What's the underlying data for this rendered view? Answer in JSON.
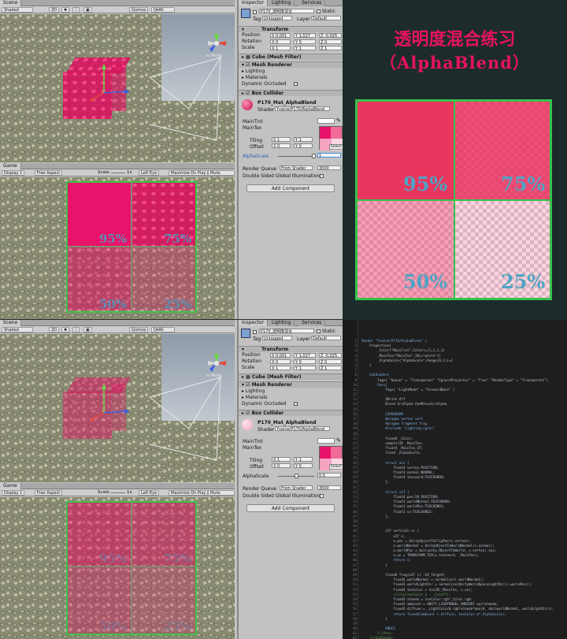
{
  "scene_tab": "Scene",
  "game_tab": "Game",
  "shaded": "Shaded",
  "mode_2d": "2D",
  "gizmos": "Gizmos",
  "gizmo_search": "Q▾All",
  "persp": "≡ Persp",
  "display": "Display 1",
  "aspect": "Free Aspect",
  "scale_label": "Scale",
  "scale_value": "1x",
  "left_eye": "Left Eye",
  "maximize": "Maximize On Play",
  "mute": "Mute Audio",
  "inspector_tab": "Inspector",
  "lighting_tab": "Lighting",
  "services_tab": "Services",
  "object_name": "P170_透明度混合",
  "static": "Static",
  "tag_label": "Tag",
  "tag_value": "Untagged",
  "layer_label": "Layer",
  "layer_value": "Default",
  "transform": {
    "title": "Transform",
    "rows": [
      {
        "label": "Position",
        "x": "0.001",
        "y": "1.027",
        "z": "-0.025"
      },
      {
        "label": "Rotation",
        "x": "0",
        "y": "0",
        "z": "0"
      },
      {
        "label": "Scale",
        "x": "1",
        "y": "1",
        "z": "1"
      }
    ]
  },
  "components": {
    "mesh_filter": "Cube (Mesh Filter)",
    "mesh_renderer": "Mesh Renderer",
    "lighting": "Lighting",
    "materials": "Materials",
    "dynamic_occluded": "Dynamic Occluded",
    "box_collider": "Box Collider"
  },
  "material": {
    "name": "P170_Mat_AlphaBlend",
    "shader_label": "Shader",
    "shader_value": "Yvaine/P170/AlphaBlend",
    "main_tint": "MainTint",
    "main_tex": "MainTex",
    "tiling": "Tiling",
    "offset": "Offset",
    "tiling_x": "1",
    "tiling_y": "1",
    "offset_x": "0",
    "offset_y": "0",
    "select": "Select",
    "alpha_scale": "AlphaScale",
    "alpha_value_top": "1",
    "alpha_value_bottom": "0.5",
    "render_queue": "Render Queue",
    "render_queue_mode": "From Shader",
    "render_queue_value": "3000",
    "double_sided": "Double Sided Global Illumination",
    "add_component": "Add Component"
  },
  "title_cn": "透明度混合练习",
  "title_en": "（AlphaBlend）",
  "percents": [
    "95%",
    "75%",
    "50%",
    "25%"
  ],
  "code_lines": [
    "Shader \"Yvaine/P170/AlphaBlend\" {",
    "    Properties{",
    "        _Color(\"MainTint\",Color)=(1,1,1,1)",
    "        _MainTex(\"MainTex\",2D)=\"white\"{}",
    "        _AlphaScale(\"AlphaScale\",Range(0,1))=1",
    "    }",
    "",
    "    SubShader{",
    "        Tags{ \"Queue\" = \"Transparent\" \"IgnoreProjector\" = \"True\" \"RenderType\" = \"Transparent\"}",
    "        Pass{",
    "            Tags{ \"LightMode\" = \"ForwardBase\" }",
    "",
    "            ZWrite Off",
    "            Blend SrcAlpha OneMinusSrcAlpha",
    "",
    "            CGPROGRAM",
    "            #pragma vertex vert",
    "            #pragma fragment frag",
    "            #include \"Lighting.cginc\"",
    "",
    "            fixed4 _Color;",
    "            sampler2D _MainTex;",
    "            float4 _MainTex_ST;",
    "            fixed _AlphaScale;",
    "",
    "            struct a2v {",
    "                float4 vertex:POSITION;",
    "                float3 normal:NORMAL;",
    "                float4 texcoord:TEXCOORD0;",
    "            };",
    "",
    "            struct v2f {",
    "                float4 pos:SV_POSITION;",
    "                float3 worldNormal:TEXCOORD0;",
    "                float3 worldPos:TEXCOORD1;",
    "                float2 uv:TEXCOORD2;",
    "            };",
    "",
    "",
    "            v2f vert(a2v v) {",
    "                v2f o;",
    "                o.pos = UnityObjectToClipPos(v.vertex);",
    "                o.worldNormal = UnityObjectToWorldNormal(v.normal);",
    "                o.worldPos = mul(unity_ObjectToWorld, v.vertex).xyz;",
    "                o.uv = TRANSFORM_TEX(v.texcoord, _MainTex);",
    "                return o;",
    "            }",
    "",
    "            fixed4 frag(v2f i) :SV_Target{",
    "                fixed3 worldNormal = normalize(i.worldNormal);",
    "                fixed3 worldLightDir = normalize(UnityWorldSpaceLightDir(i.worldPos));",
    "                fixed4 texColor = tex2D(_MainTex, i.uv);",
    "                //clip(texColor.a - _Cutoff);",
    "                fixed3 albedo = texColor.rgb*_Color.rgb;",
    "                fixed3 ambient = UNITY_LIGHTMODEL_AMBIENT.xyz*albedo;",
    "                fixed3 diffuse = _LightColor0.rgb*albedo*max(0, dot(worldNormal, worldLightDir));",
    "                return fixed4(ambient + diffuse, texColor.a*_AlphaScale);",
    "            }",
    "",
    "            ENDCG",
    "        }//Pass",
    "    }//SubShader",
    "    FallBack\"Transparent/VertexLit\"",
    "}"
  ],
  "colors": {
    "accent": "#e7135f",
    "title": "#e7135f",
    "cyan": "#4fa3c4",
    "dark_bg": "#1c2a2a"
  }
}
